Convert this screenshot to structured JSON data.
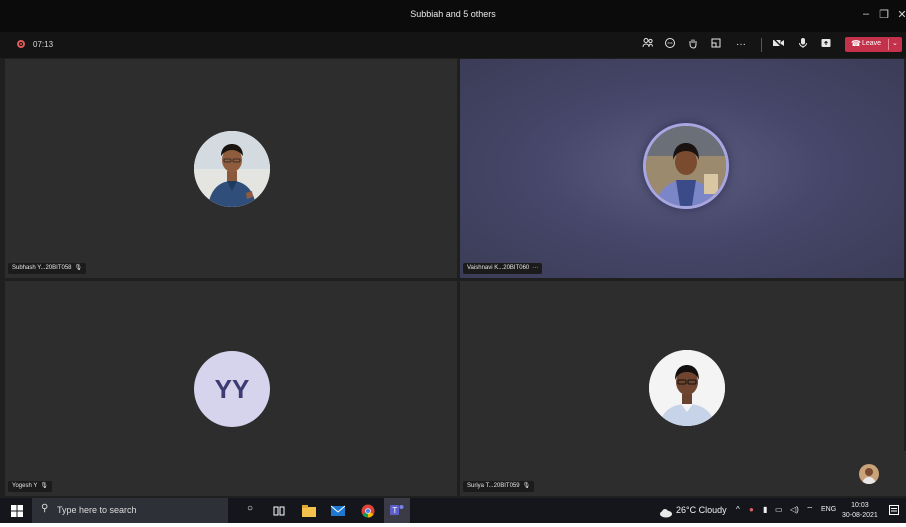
{
  "window": {
    "title": "Subbiah and 5 others"
  },
  "toolbar": {
    "timer": "07:13",
    "leave_label": "Leave"
  },
  "participants": [
    {
      "name": "Subhash Y...20BIT058"
    },
    {
      "name": "Vaishnavi K...20BIT060"
    },
    {
      "name": "Yogesh Y",
      "initials": "YY"
    },
    {
      "name": "Suriya T...20BIT059"
    }
  ],
  "taskbar": {
    "search_placeholder": "Type here to search",
    "weather": "26°C  Cloudy",
    "language": "ENG",
    "time": "10:03",
    "date": "30-08-2021"
  },
  "colors": {
    "leave": "#c4314b",
    "tile": "#2d2d2d",
    "spotlight_ring": "#a8a6e0",
    "initials_bg": "#d5d4ec",
    "initials_fg": "#3d3b72"
  }
}
